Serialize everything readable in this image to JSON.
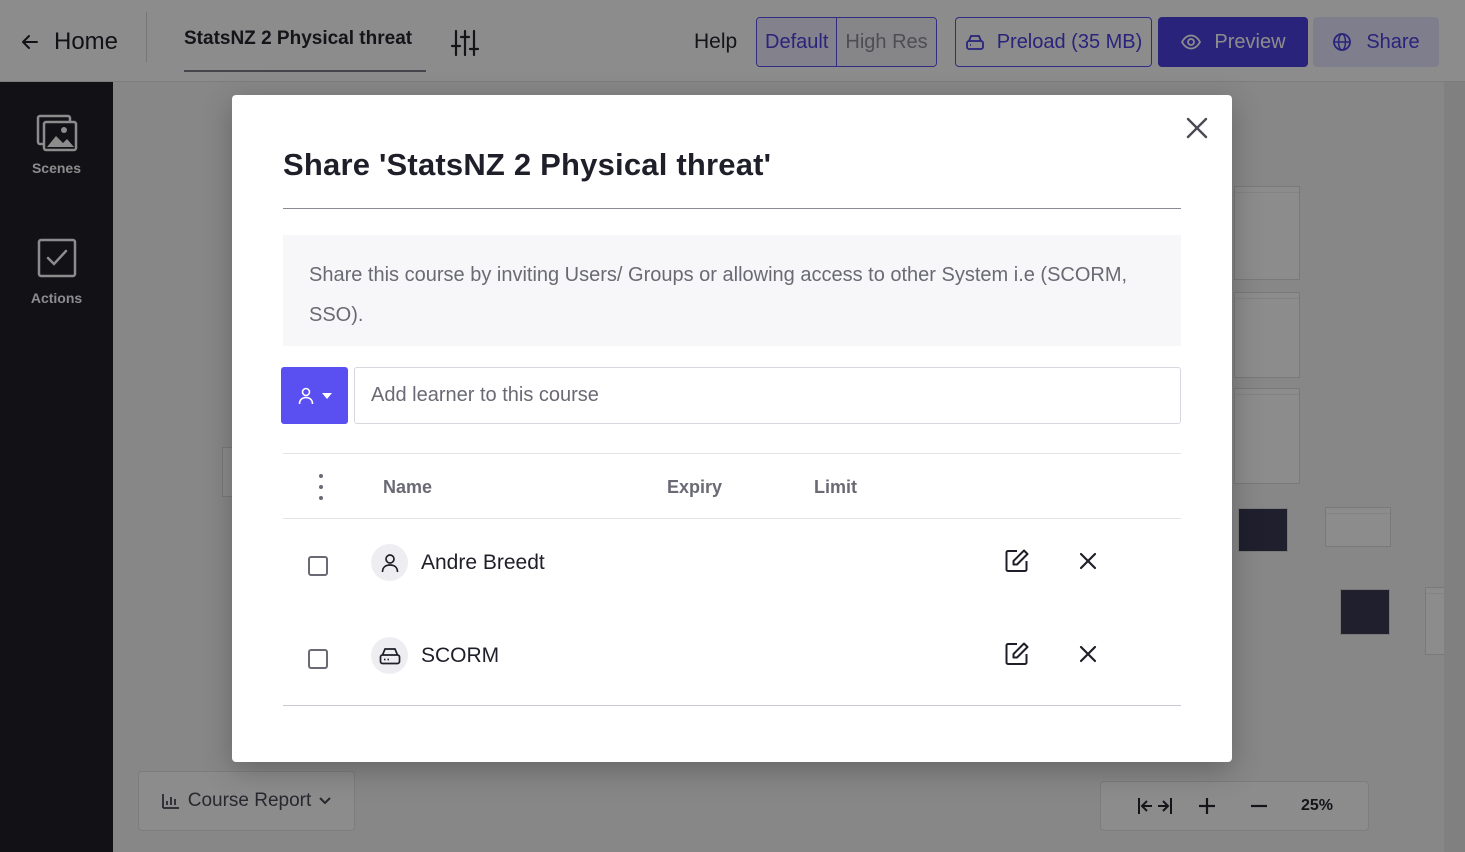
{
  "topbar": {
    "home_label": "Home",
    "course_tab": "StatsNZ 2 Physical threat",
    "help_label": "Help",
    "res_default": "Default",
    "res_high": "High Res",
    "preload_label": "Preload (35 MB)",
    "preview_label": "Preview",
    "share_label": "Share"
  },
  "sidebar": {
    "items": [
      {
        "label": "Scenes",
        "icon": "images-icon"
      },
      {
        "label": "Actions",
        "icon": "checkbox-icon"
      }
    ]
  },
  "bottom": {
    "report_label": "Course Report",
    "zoom_level": "25%"
  },
  "modal": {
    "title": "Share 'StatsNZ 2 Physical threat'",
    "description": "Share this course by inviting Users/ Groups or allowing access to other System i.e (SCORM, SSO).",
    "input_placeholder": "Add learner to this course",
    "columns": {
      "name": "Name",
      "expiry": "Expiry",
      "limit": "Limit"
    },
    "rows": [
      {
        "name": "Andre Breedt",
        "icon": "user-icon",
        "expiry": "",
        "limit": ""
      },
      {
        "name": "SCORM",
        "icon": "drive-icon",
        "expiry": "",
        "limit": ""
      }
    ]
  },
  "colors": {
    "accent": "#5a4ff0",
    "accent_dark": "#4b41e0",
    "sidebar_bg": "#1f1f29"
  }
}
